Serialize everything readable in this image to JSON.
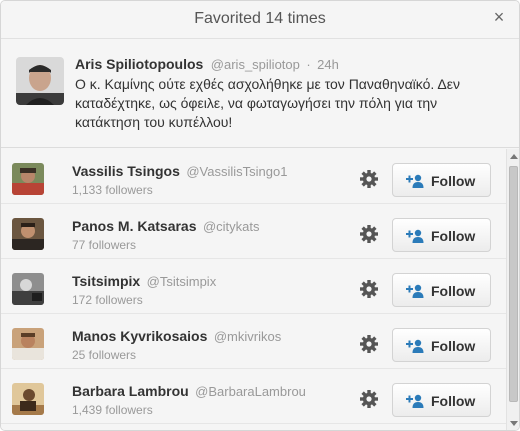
{
  "dialog": {
    "title": "Favorited 14 times",
    "close_label": "×"
  },
  "tweet": {
    "name": "Aris Spiliotopoulos",
    "handle": "@aris_spiliotop",
    "separator": "·",
    "time": "24h",
    "text": "Ο κ. Καμίνης ούτε εχθές ασχολήθηκε με τον Παναθηναϊκό. Δεν καταδέχτηκε, ως όφειλε, να φωταγωγήσει την πόλη για την κατάκτηση του κυπέλλου!"
  },
  "users": [
    {
      "name": "Vassilis Tsingos",
      "handle": "@VassilisTsingo1",
      "followers": "1,133 followers",
      "follow_label": "Follow"
    },
    {
      "name": "Panos M. Katsaras",
      "handle": "@citykats",
      "followers": "77 followers",
      "follow_label": "Follow"
    },
    {
      "name": "Tsitsimpix",
      "handle": "@Tsitsimpix",
      "followers": "172 followers",
      "follow_label": "Follow"
    },
    {
      "name": "Manos Kyvrikosaios",
      "handle": "@mkivrikos",
      "followers": "25 followers",
      "follow_label": "Follow"
    },
    {
      "name": "Barbara Lambrou",
      "handle": "@BarbaraLambrou",
      "followers": "1,439 followers",
      "follow_label": "Follow"
    }
  ],
  "colors": {
    "follow_icon": "#2b7bb9",
    "gear": "#555555"
  }
}
